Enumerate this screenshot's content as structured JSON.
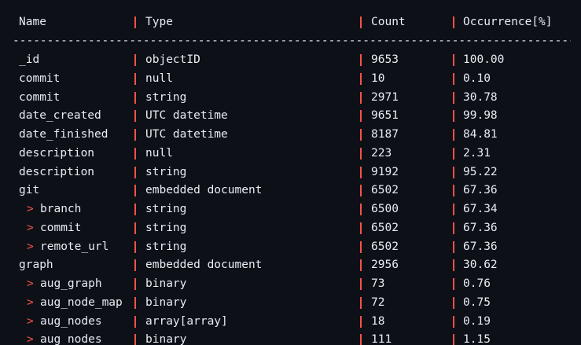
{
  "header": {
    "name": "Name",
    "type": "Type",
    "count": "Count",
    "occurrence": "Occurrence[%]"
  },
  "divider": "----------------------------------------------------------------------------------",
  "rows": [
    {
      "name": "_id",
      "type": "objectID",
      "count": "9653",
      "occ": "100.00",
      "child": false
    },
    {
      "name": "commit",
      "type": "null",
      "count": "10",
      "occ": "0.10",
      "child": false
    },
    {
      "name": "commit",
      "type": "string",
      "count": "2971",
      "occ": "30.78",
      "child": false
    },
    {
      "name": "date_created",
      "type": "UTC datetime",
      "count": "9651",
      "occ": "99.98",
      "child": false
    },
    {
      "name": "date_finished",
      "type": "UTC datetime",
      "count": "8187",
      "occ": "84.81",
      "child": false
    },
    {
      "name": "description",
      "type": "null",
      "count": "223",
      "occ": "2.31",
      "child": false
    },
    {
      "name": "description",
      "type": "string",
      "count": "9192",
      "occ": "95.22",
      "child": false
    },
    {
      "name": "git",
      "type": "embedded document",
      "count": "6502",
      "occ": "67.36",
      "child": false
    },
    {
      "name": "branch",
      "type": "string",
      "count": "6500",
      "occ": "67.34",
      "child": true
    },
    {
      "name": "commit",
      "type": "string",
      "count": "6502",
      "occ": "67.36",
      "child": true
    },
    {
      "name": "remote_url",
      "type": "string",
      "count": "6502",
      "occ": "67.36",
      "child": true
    },
    {
      "name": "graph",
      "type": "embedded document",
      "count": "2956",
      "occ": "30.62",
      "child": false
    },
    {
      "name": "aug_graph",
      "type": "binary",
      "count": "73",
      "occ": "0.76",
      "child": true
    },
    {
      "name": "aug_node_map",
      "type": "binary",
      "count": "72",
      "occ": "0.75",
      "child": true
    },
    {
      "name": "aug_nodes",
      "type": "array[array]",
      "count": "18",
      "occ": "0.19",
      "child": true
    },
    {
      "name": "aug_nodes",
      "type": "binary",
      "count": "111",
      "occ": "1.15",
      "child": true
    }
  ],
  "child_marker": ">"
}
